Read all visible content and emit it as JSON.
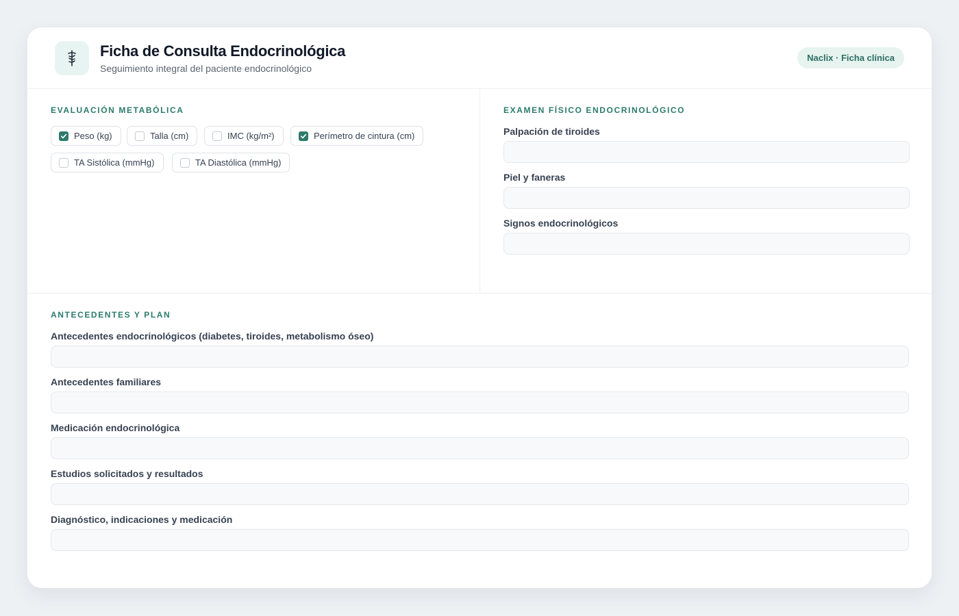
{
  "header": {
    "title": "Ficha de Consulta Endocrinológica",
    "subtitle": "Seguimiento integral del paciente endocrinológico",
    "badge": "Naclix · Ficha clínica",
    "icon": "caduceus-icon"
  },
  "metabolic": {
    "title": "EVALUACIÓN METABÓLICA",
    "options": [
      {
        "label": "Peso (kg)",
        "checked": true
      },
      {
        "label": "Talla (cm)",
        "checked": false
      },
      {
        "label": "IMC (kg/m²)",
        "checked": false
      },
      {
        "label": "Perímetro de cintura (cm)",
        "checked": true
      },
      {
        "label": "TA Sistólica (mmHg)",
        "checked": false
      },
      {
        "label": "TA Diastólica (mmHg)",
        "checked": false
      }
    ]
  },
  "physical_exam": {
    "title": "EXAMEN FÍSICO ENDOCRINOLÓGICO",
    "fields": [
      {
        "label": "Palpación de tiroides",
        "value": ""
      },
      {
        "label": "Piel y faneras",
        "value": ""
      },
      {
        "label": "Signos endocrinológicos",
        "value": ""
      }
    ]
  },
  "history_plan": {
    "title": "ANTECEDENTES Y PLAN",
    "fields": [
      {
        "label": "Antecedentes endocrinológicos (diabetes, tiroides, metabolismo óseo)",
        "value": ""
      },
      {
        "label": "Antecedentes familiares",
        "value": ""
      },
      {
        "label": "Medicación endocrinológica",
        "value": ""
      },
      {
        "label": "Estudios solicitados y resultados",
        "value": ""
      },
      {
        "label": "Diagnóstico, indicaciones y medicación",
        "value": ""
      }
    ]
  },
  "colors": {
    "accent": "#2f7a6d",
    "section_title": "#2c7a6b",
    "badge_bg": "#e6f3ef",
    "page_bg": "#eef1f4"
  }
}
